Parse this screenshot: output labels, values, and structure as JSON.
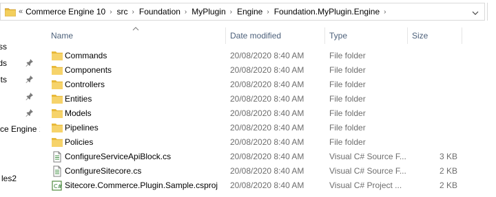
{
  "address_bar": {
    "overflow_glyph": "«",
    "segments": [
      "Commerce Engine 10",
      "src",
      "Foundation",
      "MyPlugin",
      "Engine",
      "Foundation.MyPlugin.Engine"
    ],
    "separator": "›"
  },
  "nav_pane": {
    "items": [
      {
        "label": "ss",
        "pinned": false
      },
      {
        "label": "ds",
        "pinned": true
      },
      {
        "label": "nts",
        "pinned": true
      },
      {
        "label": "",
        "pinned": true
      },
      {
        "label": "",
        "pinned": true
      },
      {
        "label": "ce Engine 1",
        "pinned": false
      },
      {
        "label": "",
        "pinned": false
      },
      {
        "label": "",
        "pinned": false
      },
      {
        "label": "",
        "pinned": false
      },
      {
        "label": "les2",
        "pinned": false
      }
    ]
  },
  "columns": {
    "name": "Name",
    "date_modified": "Date modified",
    "type": "Type",
    "size": "Size"
  },
  "files": [
    {
      "name": "Commands",
      "date": "20/08/2020 8:40 AM",
      "type": "File folder",
      "size": "",
      "icon": "folder-icon"
    },
    {
      "name": "Components",
      "date": "20/08/2020 8:40 AM",
      "type": "File folder",
      "size": "",
      "icon": "folder-icon"
    },
    {
      "name": "Controllers",
      "date": "20/08/2020 8:40 AM",
      "type": "File folder",
      "size": "",
      "icon": "folder-icon"
    },
    {
      "name": "Entities",
      "date": "20/08/2020 8:40 AM",
      "type": "File folder",
      "size": "",
      "icon": "folder-icon"
    },
    {
      "name": "Models",
      "date": "20/08/2020 8:40 AM",
      "type": "File folder",
      "size": "",
      "icon": "folder-icon"
    },
    {
      "name": "Pipelines",
      "date": "20/08/2020 8:40 AM",
      "type": "File folder",
      "size": "",
      "icon": "folder-icon"
    },
    {
      "name": "Policies",
      "date": "20/08/2020 8:40 AM",
      "type": "File folder",
      "size": "",
      "icon": "folder-icon"
    },
    {
      "name": "ConfigureServiceApiBlock.cs",
      "date": "20/08/2020 8:40 AM",
      "type": "Visual C# Source F...",
      "size": "3 KB",
      "icon": "csharp-file-icon"
    },
    {
      "name": "ConfigureSitecore.cs",
      "date": "20/08/2020 8:40 AM",
      "type": "Visual C# Source F...",
      "size": "2 KB",
      "icon": "csharp-file-icon"
    },
    {
      "name": "Sitecore.Commerce.Plugin.Sample.csproj",
      "date": "20/08/2020 8:40 AM",
      "type": "Visual C# Project ...",
      "size": "2 KB",
      "icon": "csproj-file-icon"
    }
  ],
  "colors": {
    "folder": "#e8b93a",
    "header_text": "#4c607a",
    "detail_text": "#6d6d6d"
  }
}
